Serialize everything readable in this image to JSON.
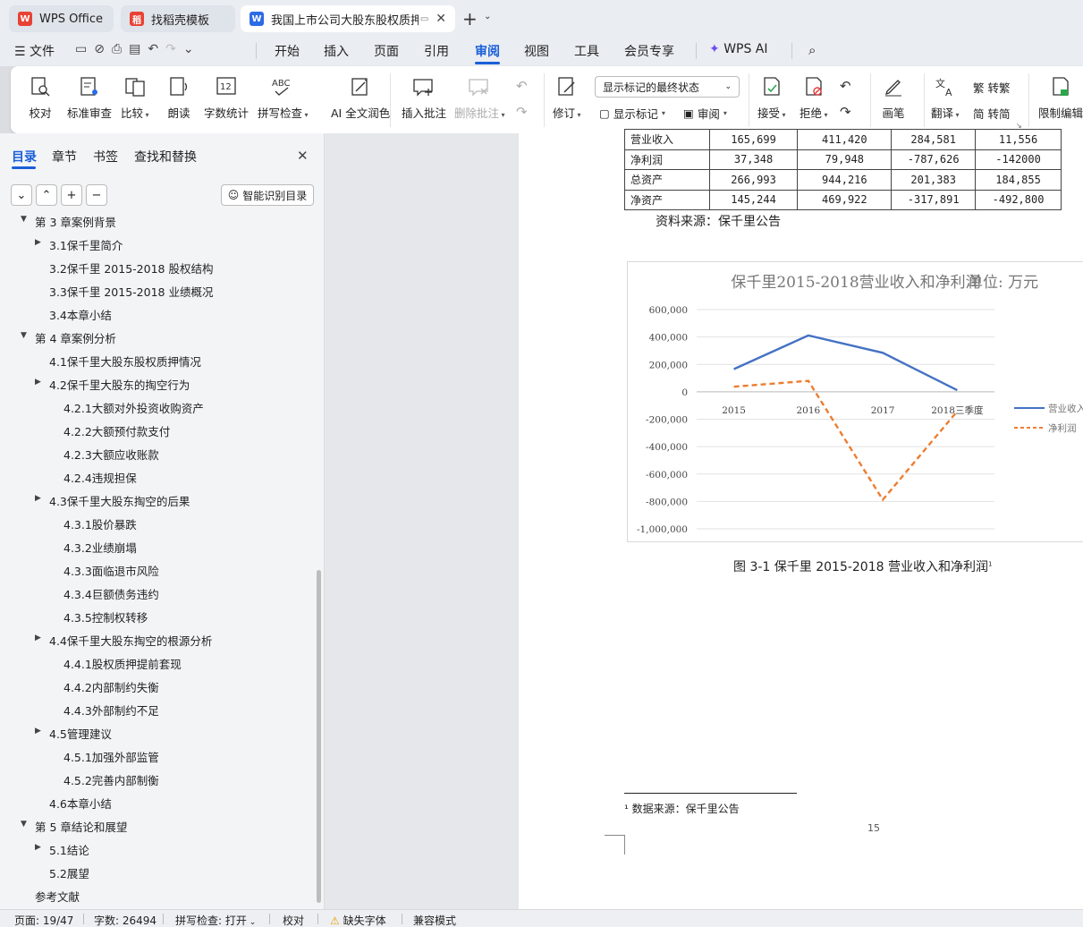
{
  "tabs": {
    "wps": "WPS Office",
    "template": "找稻壳模板",
    "doc": "我国上市公司大股东股权质押"
  },
  "menu": {
    "file": "文件",
    "items": [
      "开始",
      "插入",
      "页面",
      "引用",
      "审阅",
      "视图",
      "工具",
      "会员专享"
    ],
    "ai": "WPS AI",
    "active": "审阅"
  },
  "ribbon": {
    "proof": "校对",
    "std_review": "标准审查",
    "compare": "比较",
    "read_aloud": "朗读",
    "word_count": "字数统计",
    "spell_check": "拼写检查",
    "ai_polish": "AI 全文润色",
    "insert_comment": "插入批注",
    "delete_comment": "删除批注",
    "track": "修订",
    "display_select": "显示标记的最终状态",
    "show_markup": "显示标记",
    "review_pane": "审阅",
    "accept": "接受",
    "reject": "拒绝",
    "pen": "画笔",
    "translate": "翻译",
    "to_trad": "转繁",
    "to_simp": "转简",
    "restrict": "限制编辑",
    "spell_icon_text": "ABC",
    "count_icon_text": "12"
  },
  "nav": {
    "tabs": [
      "目录",
      "章节",
      "书签",
      "查找和替换"
    ],
    "smart_btn": "智能识别目录",
    "toc": [
      {
        "text": "第 3 章案例背景",
        "level": 1,
        "arrow": "open"
      },
      {
        "text": "3.1保千里简介",
        "level": 2,
        "arrow": "closed"
      },
      {
        "text": "3.2保千里 2015-2018 股权结构",
        "level": 2,
        "arrow": ""
      },
      {
        "text": "3.3保千里 2015-2018 业绩概况",
        "level": 2,
        "arrow": ""
      },
      {
        "text": "3.4本章小结",
        "level": 2,
        "arrow": ""
      },
      {
        "text": "第 4 章案例分析",
        "level": 1,
        "arrow": "open"
      },
      {
        "text": "4.1保千里大股东股权质押情况",
        "level": 2,
        "arrow": ""
      },
      {
        "text": "4.2保千里大股东的掏空行为",
        "level": 2,
        "arrow": "closed"
      },
      {
        "text": "4.2.1大额对外投资收购资产",
        "level": 3,
        "arrow": ""
      },
      {
        "text": "4.2.2大额预付款支付",
        "level": 3,
        "arrow": ""
      },
      {
        "text": "4.2.3大额应收账款",
        "level": 3,
        "arrow": ""
      },
      {
        "text": "4.2.4违规担保",
        "level": 3,
        "arrow": ""
      },
      {
        "text": "4.3保千里大股东掏空的后果",
        "level": 2,
        "arrow": "closed"
      },
      {
        "text": "4.3.1股价暴跌",
        "level": 3,
        "arrow": ""
      },
      {
        "text": "4.3.2业绩崩塌",
        "level": 3,
        "arrow": ""
      },
      {
        "text": "4.3.3面临退市风险",
        "level": 3,
        "arrow": ""
      },
      {
        "text": "4.3.4巨额债务违约",
        "level": 3,
        "arrow": ""
      },
      {
        "text": "4.3.5控制权转移",
        "level": 3,
        "arrow": ""
      },
      {
        "text": "4.4保千里大股东掏空的根源分析",
        "level": 2,
        "arrow": "closed"
      },
      {
        "text": "4.4.1股权质押提前套现",
        "level": 3,
        "arrow": ""
      },
      {
        "text": "4.4.2内部制约失衡",
        "level": 3,
        "arrow": ""
      },
      {
        "text": "4.4.3外部制约不足",
        "level": 3,
        "arrow": ""
      },
      {
        "text": "4.5管理建议",
        "level": 2,
        "arrow": "closed"
      },
      {
        "text": "4.5.1加强外部监管",
        "level": 3,
        "arrow": ""
      },
      {
        "text": "4.5.2完善内部制衡",
        "level": 3,
        "arrow": ""
      },
      {
        "text": "4.6本章小结",
        "level": 2,
        "arrow": ""
      },
      {
        "text": "第 5 章结论和展望",
        "level": 1,
        "arrow": "open"
      },
      {
        "text": "5.1结论",
        "level": 2,
        "arrow": "closed"
      },
      {
        "text": "5.2展望",
        "level": 2,
        "arrow": ""
      },
      {
        "text": "参考文献",
        "level": 1,
        "arrow": ""
      }
    ]
  },
  "doc": {
    "table_rows": [
      [
        "营业收入",
        "165,699",
        "411,420",
        "284,581",
        "11,556"
      ],
      [
        "净利润",
        "37,348",
        "79,948",
        "-787,626",
        "-142000"
      ],
      [
        "总资产",
        "266,993",
        "944,216",
        "201,383",
        "184,855"
      ],
      [
        "净资产",
        "145,244",
        "469,922",
        "-317,891",
        "-492,800"
      ]
    ],
    "source": "资料来源：保千里公告",
    "caption": "图 3-1 保千里 2015-2018 营业收入和净利润",
    "caption_sup": "1",
    "footnote": "¹ 数据来源：保千里公告",
    "page_number": "15"
  },
  "chart_data": {
    "type": "line",
    "title": "保千里2015-2018营业收入和净利润",
    "subtitle": "单位: 万元",
    "categories": [
      "2015",
      "2016",
      "2017",
      "2018三季度"
    ],
    "series": [
      {
        "name": "营业收入",
        "values": [
          165699,
          411420,
          284581,
          11556
        ],
        "color": "#4472c4",
        "style": "solid"
      },
      {
        "name": "净利润",
        "values": [
          37348,
          79948,
          -787626,
          -142000
        ],
        "color": "#ed7d31",
        "style": "dashed"
      }
    ],
    "yticks": [
      "600,000",
      "400,000",
      "200,000",
      "0",
      "-200,000",
      "-400,000",
      "-600,000",
      "-800,000",
      "-1,000,000"
    ],
    "ylim": [
      -1000000,
      600000
    ],
    "legend": "right",
    "grid": true
  },
  "status": {
    "page": "页面: 19/47",
    "words": "字数: 26494",
    "spell": "拼写检查: 打开",
    "proof": "校对",
    "missing_font": "缺失字体",
    "compat": "兼容模式"
  }
}
